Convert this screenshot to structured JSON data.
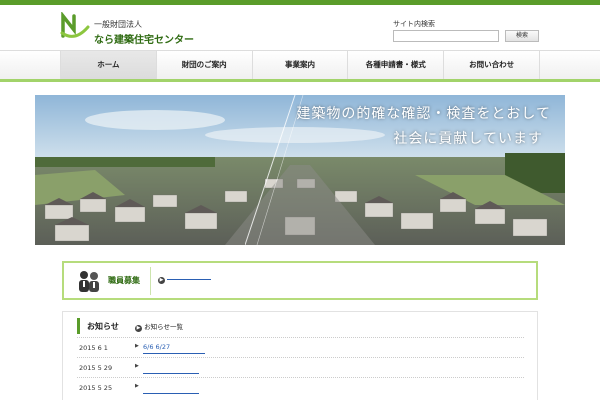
{
  "header": {
    "org_type": "一般財団法人",
    "org_name": "なら建築住宅センター",
    "search_label": "サイト内検索",
    "search_value": "",
    "search_button": "検索"
  },
  "nav": {
    "items": [
      {
        "label": "ホーム"
      },
      {
        "label": "財団のご案内"
      },
      {
        "label": "事業案内"
      },
      {
        "label": "各種申請書・様式"
      },
      {
        "label": "お問い合わせ"
      }
    ]
  },
  "hero": {
    "line1": "建築物の的確な確認・検査をとおして",
    "line2": "社会に貢献しています"
  },
  "recruit": {
    "title": "職員募集",
    "link_text": ""
  },
  "news": {
    "title": "お知らせ",
    "list_link": "お知らせ一覧",
    "items": [
      {
        "date": "2015 6 1",
        "text": "6/6 6/27"
      },
      {
        "date": "2015 5 29",
        "text": ""
      },
      {
        "date": "2015 5 25",
        "text": ""
      }
    ]
  },
  "colors": {
    "brand_green": "#5a9c2a",
    "accent_light_green": "#a2d36a",
    "link_blue": "#2a5fb3"
  }
}
